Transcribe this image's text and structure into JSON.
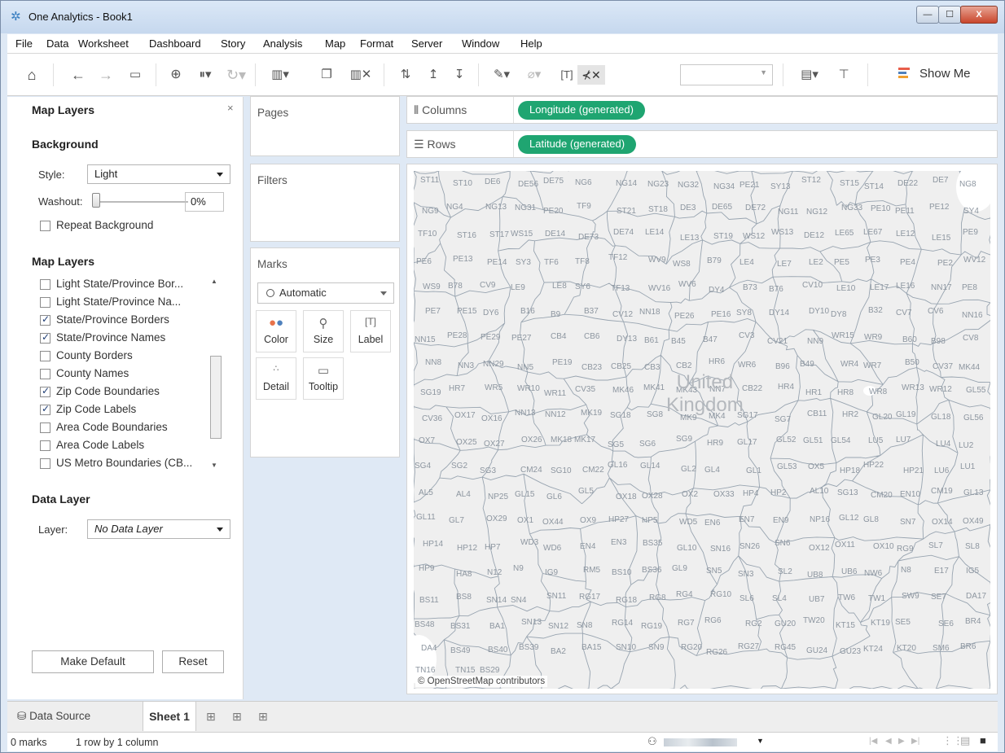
{
  "window": {
    "title": "One Analytics - Book1",
    "minimize": "—",
    "maximize": "☐",
    "close": "X"
  },
  "menu": [
    "File",
    "Data",
    "Worksheet",
    "Dashboard",
    "Story",
    "Analysis",
    "Map",
    "Format",
    "Server",
    "Window",
    "Help"
  ],
  "toolbar": {
    "show_me_label": "Show Me",
    "icons": [
      "home-icon",
      "back-icon",
      "forward-icon",
      "save-icon",
      "new-data-source-icon",
      "pause-auto-updates-icon",
      "refresh-icon",
      "new-worksheet-icon",
      "duplicate-sheet-icon",
      "clear-sheet-icon",
      "swap-rows-columns-icon",
      "sort-ascending-icon",
      "sort-descending-icon",
      "highlight-icon",
      "group-members-icon",
      "show-mark-labels-icon",
      "fix-axes-icon",
      "fit-dropdown",
      "card-layout-icon",
      "presentation-mode-icon",
      "show-me-icon"
    ]
  },
  "map_layers_panel": {
    "title": "Map Layers",
    "close": "×",
    "background": {
      "heading": "Background",
      "style_label": "Style:",
      "style_value": "Light",
      "washout_label": "Washout:",
      "washout_value": "0%",
      "repeat_label": "Repeat Background",
      "repeat_checked": false
    },
    "layers": {
      "heading": "Map Layers",
      "items": [
        {
          "label": "Light State/Province Bor...",
          "checked": false
        },
        {
          "label": "Light State/Province Na...",
          "checked": false
        },
        {
          "label": "State/Province Borders",
          "checked": true
        },
        {
          "label": "State/Province Names",
          "checked": true
        },
        {
          "label": "County Borders",
          "checked": false
        },
        {
          "label": "County Names",
          "checked": false
        },
        {
          "label": "Zip Code Boundaries",
          "checked": true
        },
        {
          "label": "Zip Code Labels",
          "checked": true
        },
        {
          "label": "Area Code Boundaries",
          "checked": false
        },
        {
          "label": "Area Code Labels",
          "checked": false
        },
        {
          "label": "US Metro Boundaries (CB...",
          "checked": false
        }
      ]
    },
    "data_layer": {
      "heading": "Data Layer",
      "layer_label": "Layer:",
      "layer_value": "No Data Layer"
    },
    "make_default": "Make Default",
    "reset": "Reset"
  },
  "cards": {
    "pages": "Pages",
    "filters": "Filters",
    "marks": {
      "title": "Marks",
      "type": "Automatic",
      "buttons": [
        {
          "label": "Color",
          "icon": "color-icon"
        },
        {
          "label": "Size",
          "icon": "size-icon"
        },
        {
          "label": "Label",
          "icon": "label-icon"
        },
        {
          "label": "Detail",
          "icon": "detail-icon"
        },
        {
          "label": "Tooltip",
          "icon": "tooltip-icon"
        }
      ]
    }
  },
  "shelves": {
    "columns_label": "Columns",
    "columns_pill": "Longitude (generated)",
    "rows_label": "Rows",
    "rows_pill": "Latitude (generated)",
    "pill_color": "#1fa571"
  },
  "map": {
    "country": "United Kingdom",
    "attribution": "© OpenStreetMap contributors",
    "labels": [
      "ST11",
      "ST10",
      "DE6",
      "DE56",
      "DE75",
      "NG6",
      "NG14",
      "NG23",
      "NG32",
      "NG34",
      "PE21",
      "SY13",
      "ST12",
      "ST15",
      "ST14",
      "DE22",
      "DE7",
      "NG8",
      "NG9",
      "NG4",
      "NG13",
      "NG31",
      "PE20",
      "TF9",
      "ST21",
      "ST18",
      "DE3",
      "DE65",
      "DE72",
      "NG11",
      "NG12",
      "NG33",
      "PE10",
      "PE11",
      "PE12",
      "SY4",
      "TF10",
      "ST16",
      "ST17",
      "WS15",
      "DE14",
      "DE73",
      "DE74",
      "LE14",
      "LE13",
      "ST19",
      "WS12",
      "WS13",
      "DE12",
      "LE65",
      "LE67",
      "LE12",
      "LE15",
      "PE9",
      "PE6",
      "PE13",
      "PE14",
      "SY3",
      "TF6",
      "TF8",
      "TF12",
      "WV9",
      "WS8",
      "B79",
      "LE4",
      "LE7",
      "LE2",
      "PE5",
      "PE3",
      "PE4",
      "PE2",
      "WV12",
      "WS9",
      "B78",
      "CV9",
      "LE9",
      "LE8",
      "SY6",
      "TF13",
      "WV16",
      "WV6",
      "DY4",
      "B73",
      "B76",
      "CV10",
      "LE10",
      "LE17",
      "LE16",
      "NN17",
      "PE8",
      "PE7",
      "PE15",
      "DY6",
      "B16",
      "B9",
      "B37",
      "CV12",
      "NN18",
      "PE26",
      "PE16",
      "SY8",
      "DY14",
      "DY10",
      "DY8",
      "B32",
      "CV7",
      "CV6",
      "NN16",
      "NN15",
      "PE28",
      "PE29",
      "PE27",
      "CB4",
      "CB6",
      "DY13",
      "B61",
      "B45",
      "B47",
      "CV3",
      "CV21",
      "NN9",
      "WR15",
      "WR9",
      "B60",
      "B98",
      "CV8",
      "NN8",
      "NN3",
      "NN29",
      "NN5",
      "PE19",
      "CB23",
      "CB25",
      "CB3",
      "CB2",
      "HR6",
      "WR6",
      "B96",
      "B49",
      "WR4",
      "WR7",
      "B50",
      "CV37",
      "MK44",
      "SG19",
      "HR7",
      "WR5",
      "WR10",
      "WR11",
      "CV35",
      "MK46",
      "MK41",
      "MK43",
      "NN7",
      "CB22",
      "HR4",
      "HR1",
      "HR8",
      "WR8",
      "WR13",
      "WR12",
      "GL55",
      "CV36",
      "OX17",
      "OX16",
      "NN13",
      "NN12",
      "MK19",
      "SG18",
      "SG8",
      "MK9",
      "MK4",
      "SG17",
      "SG7",
      "CB11",
      "HR2",
      "GL20",
      "GL19",
      "GL18",
      "GL56",
      "OX7",
      "OX25",
      "OX27",
      "OX26",
      "MK18",
      "MK17",
      "SG5",
      "SG6",
      "SG9",
      "HR9",
      "GL17",
      "GL52",
      "GL51",
      "GL54",
      "LU5",
      "LU7",
      "LU4",
      "LU2",
      "SG4",
      "SG2",
      "SG3",
      "CM24",
      "SG10",
      "CM22",
      "GL16",
      "GL14",
      "GL2",
      "GL4",
      "GL1",
      "GL53",
      "OX5",
      "HP18",
      "HP22",
      "HP21",
      "LU6",
      "LU1",
      "AL5",
      "AL4",
      "NP25",
      "GL15",
      "GL6",
      "GL5",
      "OX18",
      "OX28",
      "OX2",
      "OX33",
      "HP4",
      "HP2",
      "AL10",
      "SG13",
      "CM20",
      "EN10",
      "CM19",
      "GL13",
      "GL11",
      "GL7",
      "OX29",
      "OX1",
      "OX44",
      "OX9",
      "HP27",
      "HP5",
      "WD5",
      "EN6",
      "EN7",
      "EN9",
      "NP16",
      "GL12",
      "GL8",
      "SN7",
      "OX14",
      "OX49",
      "HP14",
      "HP12",
      "HP7",
      "WD3",
      "WD6",
      "EN4",
      "EN3",
      "BS35",
      "GL10",
      "SN16",
      "SN26",
      "SN6",
      "OX12",
      "OX11",
      "OX10",
      "RG9",
      "SL7",
      "SL8",
      "HP9",
      "HA8",
      "N12",
      "N9",
      "IG9",
      "RM5",
      "BS10",
      "BS36",
      "GL9",
      "SN5",
      "SN3",
      "SL2",
      "UB8",
      "UB6",
      "NW6",
      "N8",
      "E17",
      "IG5",
      "BS11",
      "BS8",
      "SN14",
      "SN4",
      "SN11",
      "RG17",
      "RG18",
      "RG8",
      "RG4",
      "RG10",
      "SL6",
      "SL4",
      "UB7",
      "TW6",
      "TW1",
      "SW9",
      "SE7",
      "DA17",
      "BS48",
      "BS31",
      "BA1",
      "SN13",
      "SN12",
      "SN8",
      "RG14",
      "RG19",
      "RG7",
      "RG6",
      "RG2",
      "GU20",
      "TW20",
      "KT15",
      "KT19",
      "SE5",
      "SE6",
      "BR4",
      "DA4",
      "BS49",
      "BS40",
      "BS39",
      "BA2",
      "BA15",
      "SN10",
      "SN9",
      "RG20",
      "RG26",
      "RG27",
      "RG45",
      "GU24",
      "GU23",
      "KT24",
      "KT20",
      "SM6",
      "BR6",
      "TN16",
      "TN15",
      "BS29"
    ],
    "background_color": "#efefef",
    "border_color": "#98a4b0",
    "label_color": "#8d96a0"
  },
  "tabs": {
    "data_source": "Data Source",
    "sheet": "Sheet 1",
    "new_worksheet_icon": "new-worksheet-icon",
    "new_dashboard_icon": "new-dashboard-icon",
    "new_story_icon": "new-story-icon"
  },
  "status": {
    "marks": "0 marks",
    "dimensions": "1 row by 1 column"
  }
}
